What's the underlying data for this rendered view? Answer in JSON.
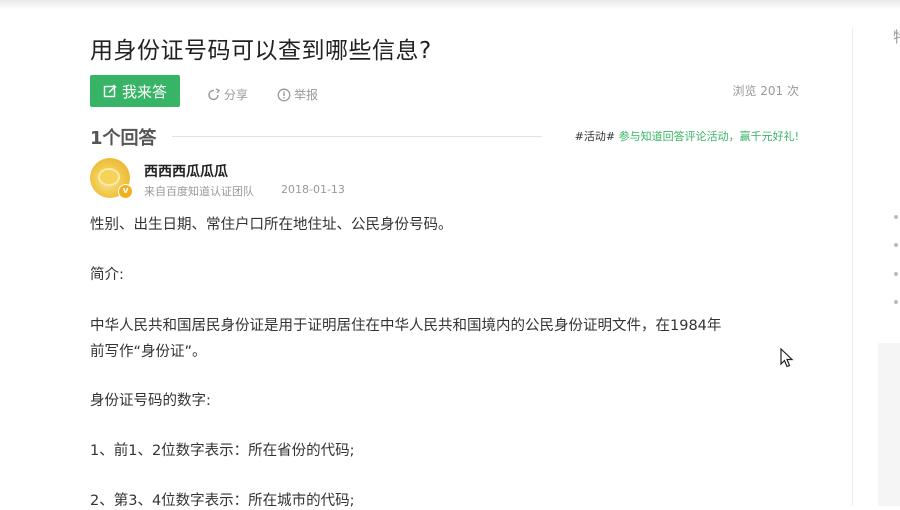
{
  "question": {
    "title": "用身份证号码可以查到哪些信息?",
    "answer_button": "我来答",
    "share": "分享",
    "report": "举报",
    "views": "浏览 201 次"
  },
  "answers_header": {
    "count": "1个回答",
    "activity_tag": "#活动#",
    "activity_link": "参与知道回答评论活动，赢千元好礼!"
  },
  "answer": {
    "user_name": "西西西瓜瓜瓜",
    "source": "来自百度知道认证团队",
    "date": "2018-01-13",
    "badge": "v",
    "paragraphs": [
      "性别、出生日期、常住户口所在地住址、公民身份号码。",
      "简介:",
      "中华人民共和国居民身份证是用于证明居住在中华人民共和国境内的公民身份证明文件，在1984年",
      "前写作“身份证”。",
      "身份证号码的数字:",
      "1、前1、2位数字表示：所在省份的代码;",
      "2、第3、4位数字表示：所在城市的代码;"
    ]
  },
  "sidebar": {
    "glyph": "特"
  },
  "colors": {
    "accent_green": "#38b466",
    "muted_text": "#999999"
  }
}
